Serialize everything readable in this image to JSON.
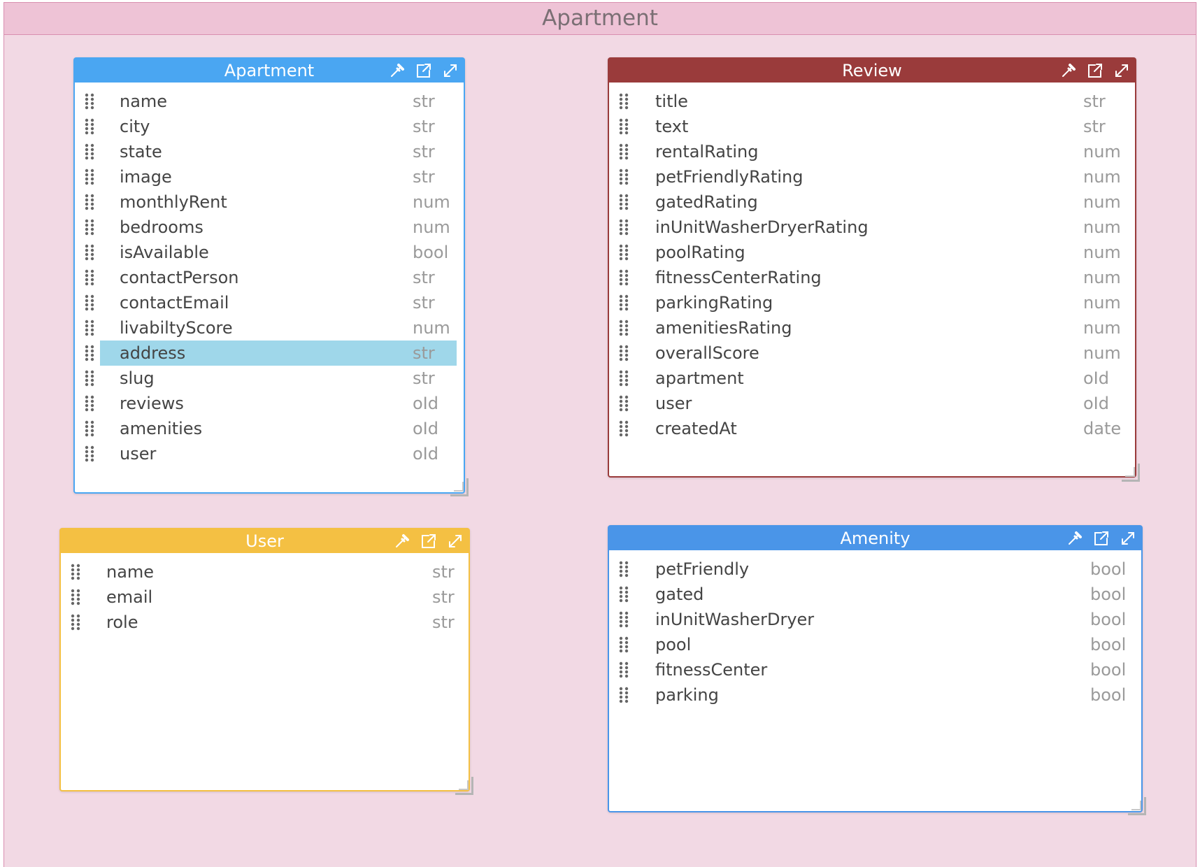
{
  "canvas": {
    "title": "Apartment"
  },
  "models": {
    "apartment": {
      "title": "Apartment",
      "color": "#4aa6f2",
      "fields": [
        {
          "name": "name",
          "type": "str"
        },
        {
          "name": "city",
          "type": "str"
        },
        {
          "name": "state",
          "type": "str"
        },
        {
          "name": "image",
          "type": "str"
        },
        {
          "name": "monthlyRent",
          "type": "num"
        },
        {
          "name": "bedrooms",
          "type": "num"
        },
        {
          "name": "isAvailable",
          "type": "bool"
        },
        {
          "name": "contactPerson",
          "type": "str"
        },
        {
          "name": "contactEmail",
          "type": "str"
        },
        {
          "name": "livabiltyScore",
          "type": "num"
        },
        {
          "name": "address",
          "type": "str"
        },
        {
          "name": "slug",
          "type": "str"
        },
        {
          "name": "reviews",
          "type": "oId"
        },
        {
          "name": "amenities",
          "type": "oId"
        },
        {
          "name": "user",
          "type": "oId"
        }
      ],
      "selected_field": "address"
    },
    "review": {
      "title": "Review",
      "color": "#9a3b3b",
      "fields": [
        {
          "name": "title",
          "type": "str"
        },
        {
          "name": "text",
          "type": "str"
        },
        {
          "name": "rentalRating",
          "type": "num"
        },
        {
          "name": "petFriendlyRating",
          "type": "num"
        },
        {
          "name": "gatedRating",
          "type": "num"
        },
        {
          "name": "inUnitWasherDryerRating",
          "type": "num"
        },
        {
          "name": "poolRating",
          "type": "num"
        },
        {
          "name": "fitnessCenterRating",
          "type": "num"
        },
        {
          "name": "parkingRating",
          "type": "num"
        },
        {
          "name": "amenitiesRating",
          "type": "num"
        },
        {
          "name": "overallScore",
          "type": "num"
        },
        {
          "name": "apartment",
          "type": "oId"
        },
        {
          "name": "user",
          "type": "oId"
        },
        {
          "name": "createdAt",
          "type": "date"
        }
      ]
    },
    "user": {
      "title": "User",
      "color": "#f4c043",
      "fields": [
        {
          "name": "name",
          "type": "str"
        },
        {
          "name": "email",
          "type": "str"
        },
        {
          "name": "role",
          "type": "str"
        }
      ]
    },
    "amenity": {
      "title": "Amenity",
      "color": "#4a95e8",
      "fields": [
        {
          "name": "petFriendly",
          "type": "bool"
        },
        {
          "name": "gated",
          "type": "bool"
        },
        {
          "name": "inUnitWasherDryer",
          "type": "bool"
        },
        {
          "name": "pool",
          "type": "bool"
        },
        {
          "name": "fitnessCenter",
          "type": "bool"
        },
        {
          "name": "parking",
          "type": "bool"
        }
      ]
    }
  },
  "icons": {
    "pin": "eyedropper-icon",
    "open": "external-link-icon",
    "expand": "expand-icon",
    "drag": "drag-handle-icon"
  }
}
